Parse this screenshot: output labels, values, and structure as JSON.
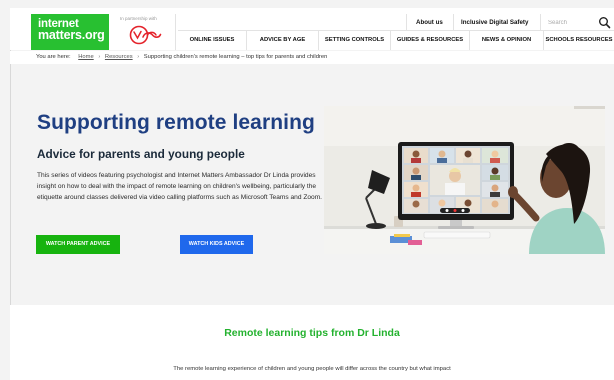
{
  "brand": {
    "logo_line1": "internet",
    "logo_line2": "matters.org",
    "partner_label": "In partnership with",
    "partner_logo": "virgin-media-logo",
    "brand_green": "#28c031",
    "brand_blue": "#1f3f82",
    "partner_red": "#e4232b"
  },
  "top_links": {
    "about": "About us",
    "ids": "Inclusive Digital Safety"
  },
  "search": {
    "placeholder": "Search",
    "icon": "search-icon"
  },
  "main_nav": {
    "items": [
      "ONLINE ISSUES",
      "ADVICE BY AGE",
      "SETTING CONTROLS",
      "GUIDES & RESOURCES",
      "NEWS & OPINION",
      "SCHOOLS RESOURCES"
    ]
  },
  "breadcrumb": {
    "prefix": "You are here:",
    "items": [
      "Home",
      "Resources",
      "Supporting children's remote learning – top tips for parents and children"
    ]
  },
  "hero": {
    "title": "Supporting remote learning",
    "subtitle": "Advice for parents and young people",
    "description": "This series of videos featuring psychologist and Internet Matters Ambassador Dr Linda provides insight on how to deal with the impact of remote learning on children's wellbeing, particularly the etiquette around classes delivered via video calling platforms such as Microsoft Teams and Zoom.",
    "btn_parent": "WATCH PARENT ADVICE",
    "btn_kids": "WATCH KIDS ADVICE",
    "btn_parent_color": "#17b30f",
    "btn_kids_color": "#1f68ec"
  },
  "tips": {
    "title": "Remote learning tips from Dr Linda",
    "intro": "The remote learning experience of children and young people will differ across the country but what impact",
    "title_color": "#24b22f"
  }
}
